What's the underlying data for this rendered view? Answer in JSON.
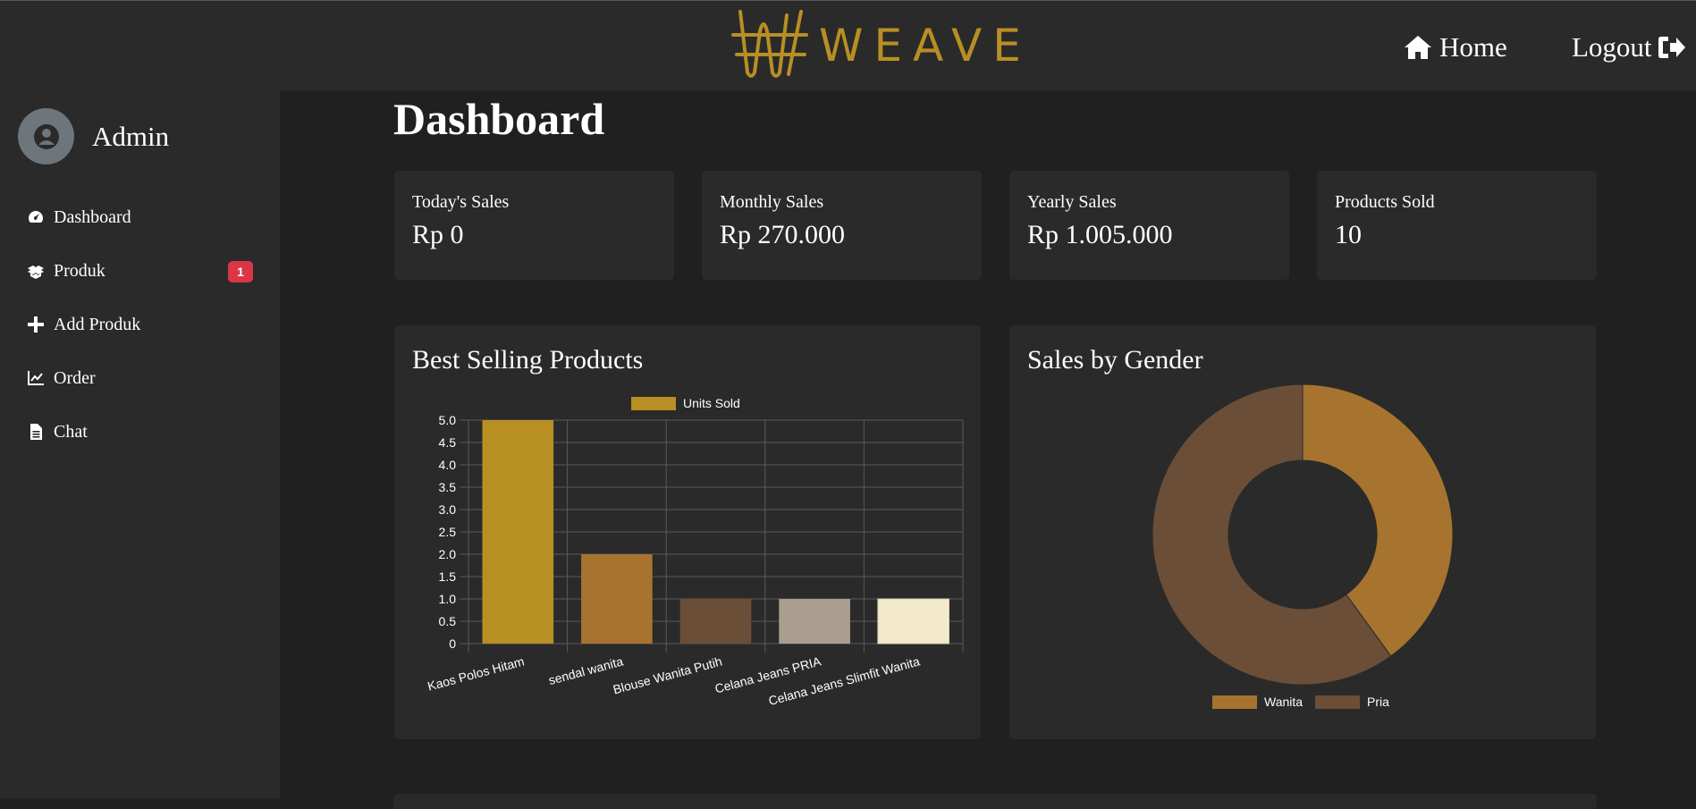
{
  "header": {
    "brand": "WEAVE",
    "nav": {
      "home": "Home",
      "logout": "Logout"
    },
    "brand_color": "#b88f23"
  },
  "sidebar": {
    "user": "Admin",
    "items": [
      {
        "label": "Dashboard",
        "icon": "gauge-icon"
      },
      {
        "label": "Produk",
        "icon": "boxes-icon",
        "badge": "1"
      },
      {
        "label": "Add Produk",
        "icon": "plus-icon"
      },
      {
        "label": "Order",
        "icon": "line-chart-icon"
      },
      {
        "label": "Chat",
        "icon": "file-icon"
      }
    ]
  },
  "main": {
    "title": "Dashboard",
    "stats": [
      {
        "label": "Today's Sales",
        "value": "Rp 0"
      },
      {
        "label": "Monthly Sales",
        "value": "Rp 270.000"
      },
      {
        "label": "Yearly Sales",
        "value": "Rp 1.005.000"
      },
      {
        "label": "Products Sold",
        "value": "10"
      }
    ]
  },
  "chart_data": [
    {
      "type": "bar",
      "title": "Best Selling Products",
      "categories": [
        "Kaos Polos Hitam",
        "sendal wanita",
        "Blouse Wanita Putih",
        "Celana Jeans PRIA",
        "Celana Jeans Slimfit Wanita"
      ],
      "series": [
        {
          "name": "Units Sold",
          "values": [
            5,
            2,
            1,
            1,
            1
          ]
        }
      ],
      "bar_colors": [
        "#b88f23",
        "#a6742f",
        "#6b4e37",
        "#a99e8f",
        "#f3eacb"
      ],
      "ylim": [
        0,
        5
      ],
      "yticks": [
        "5.0",
        "4.5",
        "4.0",
        "3.5",
        "3.0",
        "2.5",
        "2.0",
        "1.5",
        "1.0",
        "0.5",
        "0"
      ],
      "grid": true,
      "legend": "top"
    },
    {
      "type": "pie",
      "title": "Sales by Gender",
      "labels": [
        "Wanita",
        "Pria"
      ],
      "values": [
        4,
        6
      ],
      "colors": [
        "#a6742f",
        "#6b4e37"
      ],
      "legend": "bottom"
    }
  ]
}
